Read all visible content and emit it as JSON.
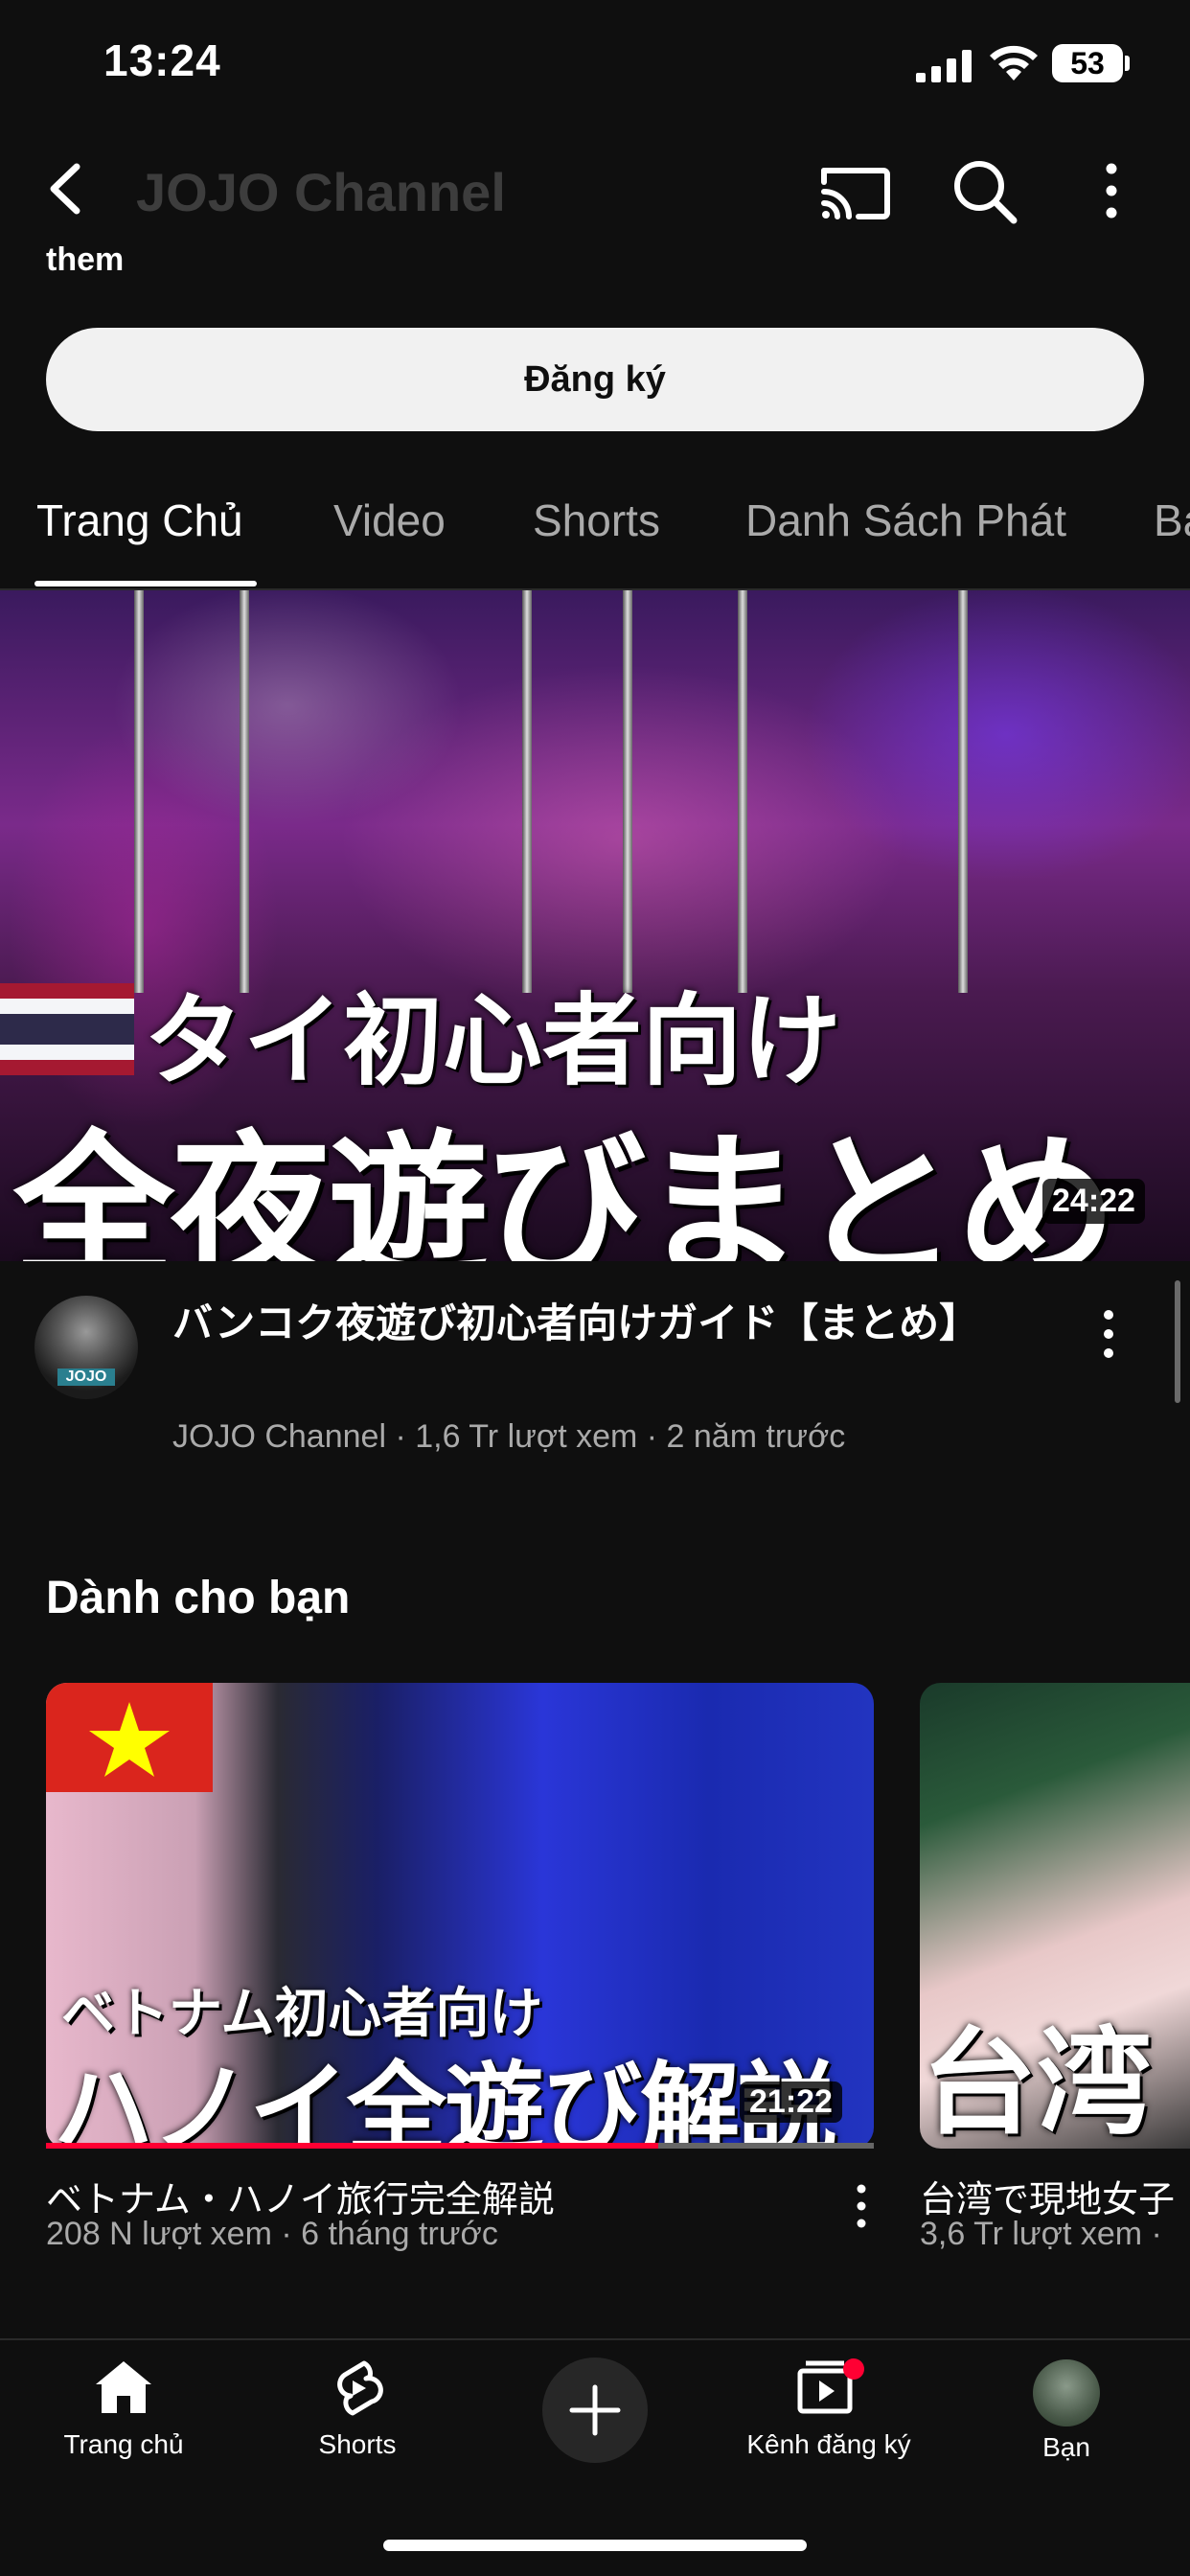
{
  "status_bar": {
    "time": "13:24",
    "battery": "53"
  },
  "header": {
    "title": "JOJO Channel"
  },
  "channel": {
    "partial_text": "them",
    "subscribe_label": "Đăng ký"
  },
  "tabs": [
    {
      "label": "Trang Chủ",
      "active": true
    },
    {
      "label": "Video",
      "active": false
    },
    {
      "label": "Shorts",
      "active": false
    },
    {
      "label": "Danh Sách Phát",
      "active": false
    },
    {
      "label": "Ba",
      "active": false
    }
  ],
  "featured_video": {
    "thumbnail_line1": "タイ初心者向け",
    "thumbnail_line2": "全夜遊びまとめ",
    "duration": "24:22",
    "avatar_label": "JOJO",
    "title": "バンコク夜遊び初心者向けガイド【まとめ】",
    "meta": "JOJO Channel · 1,6 Tr lượt xem · 2 năm trước"
  },
  "for_you": {
    "title": "Dành cho bạn",
    "cards": [
      {
        "thumbnail_line1": "ベトナム初心者向け",
        "thumbnail_line2": "ハノイ全遊び解説",
        "duration": "21:22",
        "progress": 0.74,
        "title": "ベトナム・ハノイ旅行完全解説",
        "meta": "208 N lượt xem · 6 tháng trước"
      },
      {
        "thumbnail_text": "台湾",
        "title": "台湾で現地女子",
        "meta": "3,6 Tr lượt xem ·"
      }
    ]
  },
  "bottom_nav": [
    {
      "label": "Trang chủ",
      "icon": "home-icon"
    },
    {
      "label": "Shorts",
      "icon": "shorts-icon"
    },
    {
      "label": "",
      "icon": "plus-icon"
    },
    {
      "label": "Kênh đăng ký",
      "icon": "subscriptions-icon"
    },
    {
      "label": "Bạn",
      "icon": "avatar"
    }
  ],
  "colors": {
    "background": "#0f0f0f",
    "accent": "#ff0033",
    "secondary_text": "#aaaaaa"
  }
}
